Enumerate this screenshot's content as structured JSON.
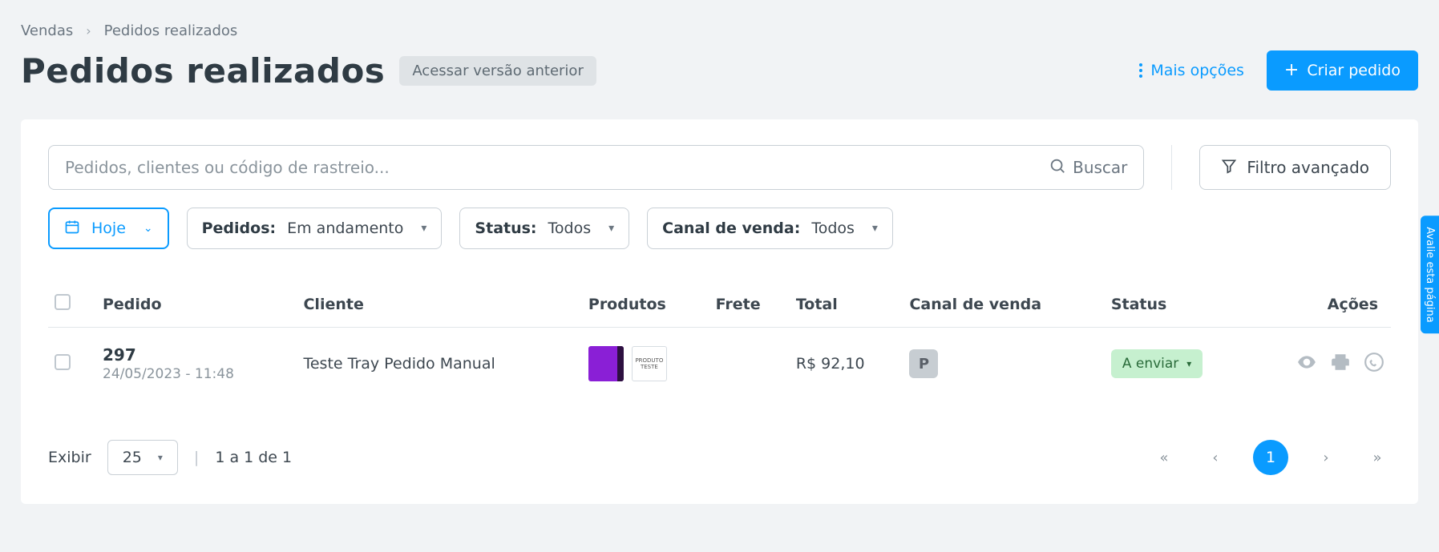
{
  "breadcrumb": {
    "root": "Vendas",
    "current": "Pedidos realizados"
  },
  "page_title": "Pedidos realizados",
  "old_version_btn": "Acessar versão anterior",
  "more_options": "Mais opções",
  "create_order": "Criar pedido",
  "search": {
    "placeholder": "Pedidos, clientes ou código de rastreio...",
    "button": "Buscar"
  },
  "advanced_filter": "Filtro avançado",
  "filters": {
    "date": "Hoje",
    "orders_label": "Pedidos:",
    "orders_value": "Em andamento",
    "status_label": "Status:",
    "status_value": "Todos",
    "channel_label": "Canal de venda:",
    "channel_value": "Todos"
  },
  "table": {
    "headers": {
      "order": "Pedido",
      "client": "Cliente",
      "products": "Produtos",
      "freight": "Frete",
      "total": "Total",
      "channel": "Canal de venda",
      "status": "Status",
      "actions": "Ações"
    },
    "rows": [
      {
        "order_number": "297",
        "order_date": "24/05/2023 - 11:48",
        "client": "Teste Tray Pedido Manual",
        "freight": "",
        "total": "R$ 92,10",
        "channel_badge": "P",
        "status": "A enviar"
      }
    ]
  },
  "footer": {
    "show_label": "Exibir",
    "page_size": "25",
    "range": "1 a 1 de 1",
    "current_page": "1"
  },
  "side_tab": "Avalie esta página"
}
